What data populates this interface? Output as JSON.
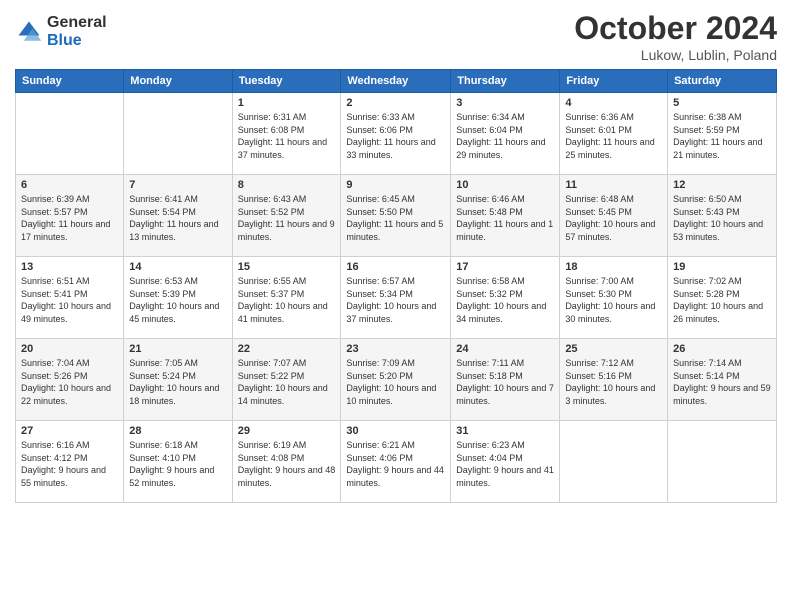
{
  "logo": {
    "general": "General",
    "blue": "Blue"
  },
  "title": {
    "month": "October 2024",
    "location": "Lukow, Lublin, Poland"
  },
  "weekdays": [
    "Sunday",
    "Monday",
    "Tuesday",
    "Wednesday",
    "Thursday",
    "Friday",
    "Saturday"
  ],
  "weeks": [
    [
      {
        "day": "",
        "info": ""
      },
      {
        "day": "",
        "info": ""
      },
      {
        "day": "1",
        "info": "Sunrise: 6:31 AM\nSunset: 6:08 PM\nDaylight: 11 hours and 37 minutes."
      },
      {
        "day": "2",
        "info": "Sunrise: 6:33 AM\nSunset: 6:06 PM\nDaylight: 11 hours and 33 minutes."
      },
      {
        "day": "3",
        "info": "Sunrise: 6:34 AM\nSunset: 6:04 PM\nDaylight: 11 hours and 29 minutes."
      },
      {
        "day": "4",
        "info": "Sunrise: 6:36 AM\nSunset: 6:01 PM\nDaylight: 11 hours and 25 minutes."
      },
      {
        "day": "5",
        "info": "Sunrise: 6:38 AM\nSunset: 5:59 PM\nDaylight: 11 hours and 21 minutes."
      }
    ],
    [
      {
        "day": "6",
        "info": "Sunrise: 6:39 AM\nSunset: 5:57 PM\nDaylight: 11 hours and 17 minutes."
      },
      {
        "day": "7",
        "info": "Sunrise: 6:41 AM\nSunset: 5:54 PM\nDaylight: 11 hours and 13 minutes."
      },
      {
        "day": "8",
        "info": "Sunrise: 6:43 AM\nSunset: 5:52 PM\nDaylight: 11 hours and 9 minutes."
      },
      {
        "day": "9",
        "info": "Sunrise: 6:45 AM\nSunset: 5:50 PM\nDaylight: 11 hours and 5 minutes."
      },
      {
        "day": "10",
        "info": "Sunrise: 6:46 AM\nSunset: 5:48 PM\nDaylight: 11 hours and 1 minute."
      },
      {
        "day": "11",
        "info": "Sunrise: 6:48 AM\nSunset: 5:45 PM\nDaylight: 10 hours and 57 minutes."
      },
      {
        "day": "12",
        "info": "Sunrise: 6:50 AM\nSunset: 5:43 PM\nDaylight: 10 hours and 53 minutes."
      }
    ],
    [
      {
        "day": "13",
        "info": "Sunrise: 6:51 AM\nSunset: 5:41 PM\nDaylight: 10 hours and 49 minutes."
      },
      {
        "day": "14",
        "info": "Sunrise: 6:53 AM\nSunset: 5:39 PM\nDaylight: 10 hours and 45 minutes."
      },
      {
        "day": "15",
        "info": "Sunrise: 6:55 AM\nSunset: 5:37 PM\nDaylight: 10 hours and 41 minutes."
      },
      {
        "day": "16",
        "info": "Sunrise: 6:57 AM\nSunset: 5:34 PM\nDaylight: 10 hours and 37 minutes."
      },
      {
        "day": "17",
        "info": "Sunrise: 6:58 AM\nSunset: 5:32 PM\nDaylight: 10 hours and 34 minutes."
      },
      {
        "day": "18",
        "info": "Sunrise: 7:00 AM\nSunset: 5:30 PM\nDaylight: 10 hours and 30 minutes."
      },
      {
        "day": "19",
        "info": "Sunrise: 7:02 AM\nSunset: 5:28 PM\nDaylight: 10 hours and 26 minutes."
      }
    ],
    [
      {
        "day": "20",
        "info": "Sunrise: 7:04 AM\nSunset: 5:26 PM\nDaylight: 10 hours and 22 minutes."
      },
      {
        "day": "21",
        "info": "Sunrise: 7:05 AM\nSunset: 5:24 PM\nDaylight: 10 hours and 18 minutes."
      },
      {
        "day": "22",
        "info": "Sunrise: 7:07 AM\nSunset: 5:22 PM\nDaylight: 10 hours and 14 minutes."
      },
      {
        "day": "23",
        "info": "Sunrise: 7:09 AM\nSunset: 5:20 PM\nDaylight: 10 hours and 10 minutes."
      },
      {
        "day": "24",
        "info": "Sunrise: 7:11 AM\nSunset: 5:18 PM\nDaylight: 10 hours and 7 minutes."
      },
      {
        "day": "25",
        "info": "Sunrise: 7:12 AM\nSunset: 5:16 PM\nDaylight: 10 hours and 3 minutes."
      },
      {
        "day": "26",
        "info": "Sunrise: 7:14 AM\nSunset: 5:14 PM\nDaylight: 9 hours and 59 minutes."
      }
    ],
    [
      {
        "day": "27",
        "info": "Sunrise: 6:16 AM\nSunset: 4:12 PM\nDaylight: 9 hours and 55 minutes."
      },
      {
        "day": "28",
        "info": "Sunrise: 6:18 AM\nSunset: 4:10 PM\nDaylight: 9 hours and 52 minutes."
      },
      {
        "day": "29",
        "info": "Sunrise: 6:19 AM\nSunset: 4:08 PM\nDaylight: 9 hours and 48 minutes."
      },
      {
        "day": "30",
        "info": "Sunrise: 6:21 AM\nSunset: 4:06 PM\nDaylight: 9 hours and 44 minutes."
      },
      {
        "day": "31",
        "info": "Sunrise: 6:23 AM\nSunset: 4:04 PM\nDaylight: 9 hours and 41 minutes."
      },
      {
        "day": "",
        "info": ""
      },
      {
        "day": "",
        "info": ""
      }
    ]
  ]
}
